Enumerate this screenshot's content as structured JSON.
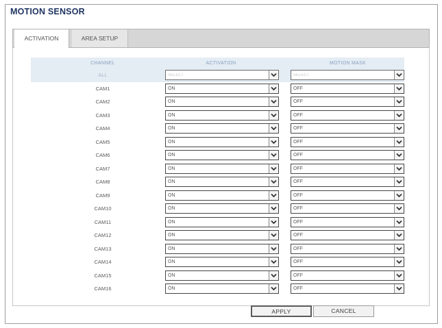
{
  "window": {
    "title": "MOTION SENSOR"
  },
  "tabs": [
    {
      "label": "ACTIVATION",
      "active": true
    },
    {
      "label": "AREA SETUP",
      "active": false
    }
  ],
  "table": {
    "headers": {
      "channel": "CHANNEL",
      "activation": "ACTIVATION",
      "motion_mask": "MOTION MASK"
    },
    "all_row": {
      "channel": "ALL",
      "activation": "SELECT",
      "motion_mask": "SELECT"
    },
    "rows": [
      {
        "channel": "CAM1",
        "activation": "ON",
        "motion_mask": "OFF"
      },
      {
        "channel": "CAM2",
        "activation": "ON",
        "motion_mask": "OFF"
      },
      {
        "channel": "CAM3",
        "activation": "ON",
        "motion_mask": "OFF"
      },
      {
        "channel": "CAM4",
        "activation": "ON",
        "motion_mask": "OFF"
      },
      {
        "channel": "CAM5",
        "activation": "ON",
        "motion_mask": "OFF"
      },
      {
        "channel": "CAM6",
        "activation": "ON",
        "motion_mask": "OFF"
      },
      {
        "channel": "CAM7",
        "activation": "ON",
        "motion_mask": "OFF"
      },
      {
        "channel": "CAM8",
        "activation": "ON",
        "motion_mask": "OFF"
      },
      {
        "channel": "CAM9",
        "activation": "ON",
        "motion_mask": "OFF"
      },
      {
        "channel": "CAM10",
        "activation": "ON",
        "motion_mask": "OFF"
      },
      {
        "channel": "CAM11",
        "activation": "ON",
        "motion_mask": "OFF"
      },
      {
        "channel": "CAM12",
        "activation": "ON",
        "motion_mask": "OFF"
      },
      {
        "channel": "CAM13",
        "activation": "ON",
        "motion_mask": "OFF"
      },
      {
        "channel": "CAM14",
        "activation": "ON",
        "motion_mask": "OFF"
      },
      {
        "channel": "CAM15",
        "activation": "ON",
        "motion_mask": "OFF"
      },
      {
        "channel": "CAM16",
        "activation": "ON",
        "motion_mask": "OFF"
      }
    ]
  },
  "buttons": {
    "apply": "APPLY",
    "cancel": "CANCEL"
  },
  "icons": {
    "dropdown": "chevron-down-icon"
  },
  "colors": {
    "title": "#1f3562",
    "header_bg": "#e4ecf4",
    "header_text": "#8aa2bf"
  }
}
